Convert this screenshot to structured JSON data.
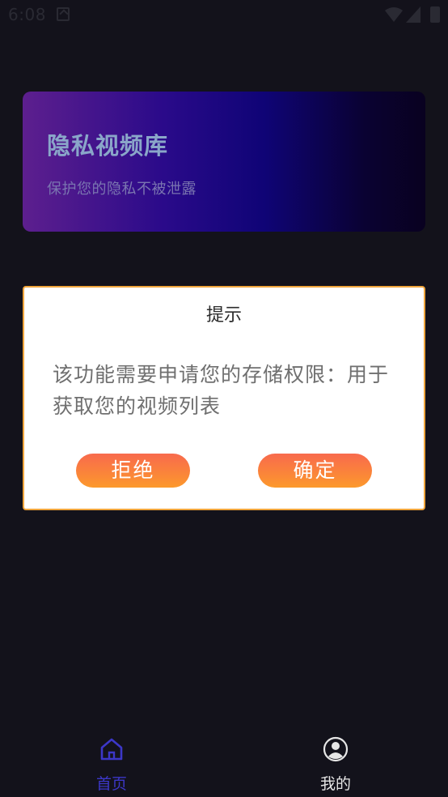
{
  "status_bar": {
    "time": "6:08",
    "icons": [
      "notification-icon",
      "wifi-icon",
      "signal-icon",
      "battery-icon"
    ]
  },
  "banner": {
    "title": "隐私视频库",
    "subtitle": "保护您的隐私不被泄露"
  },
  "dialog": {
    "title": "提示",
    "message": "该功能需要申请您的存储权限：用于获取您的视频列表",
    "reject_label": "拒绝",
    "confirm_label": "确定"
  },
  "bottom_nav": {
    "items": [
      {
        "label": "首页",
        "icon": "home-icon",
        "active": true
      },
      {
        "label": "我的",
        "icon": "profile-icon",
        "active": false
      }
    ]
  },
  "colors": {
    "background": "#13121b",
    "accent": "#3c37c8",
    "dialog_border": "#f0a53c",
    "button_gradient_start": "#f86a4d",
    "button_gradient_end": "#fc9a2c"
  }
}
